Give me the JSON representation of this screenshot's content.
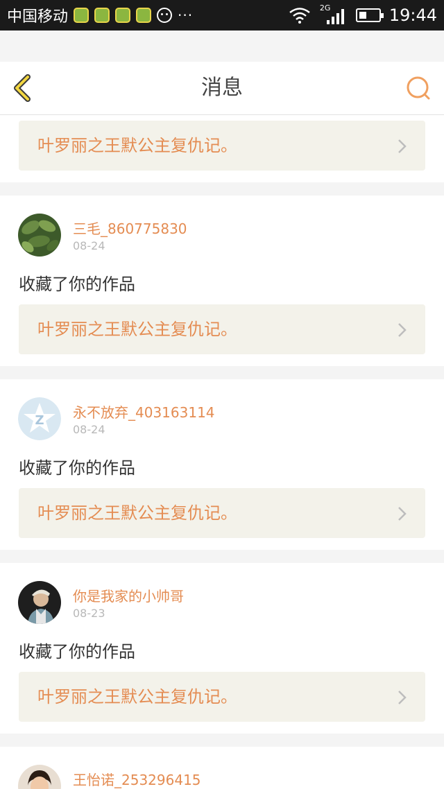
{
  "status_bar": {
    "carrier": "中国移动",
    "time": "19:44",
    "network": "2G",
    "more": "···"
  },
  "header": {
    "title": "消息",
    "accent_color": "#e48c52"
  },
  "messages": [
    {
      "work_title": "叶罗丽之王默公主复仇记。"
    },
    {
      "username": "三毛_860775830",
      "date": "08-24",
      "action": "收藏了你的作品",
      "work_title": "叶罗丽之王默公主复仇记。"
    },
    {
      "username": "永不放弃_403163114",
      "date": "08-24",
      "action": "收藏了你的作品",
      "work_title": "叶罗丽之王默公主复仇记。"
    },
    {
      "username": "你是我家的小帅哥",
      "date": "08-23",
      "action": "收藏了你的作品",
      "work_title": "叶罗丽之王默公主复仇记。"
    },
    {
      "username": "王怡诺_253296415"
    }
  ]
}
